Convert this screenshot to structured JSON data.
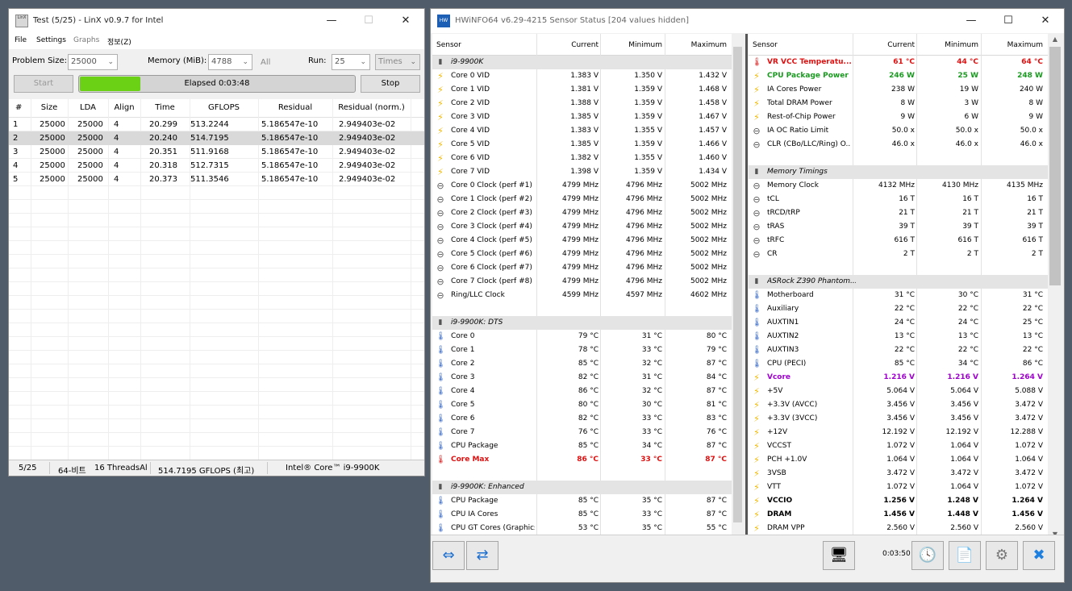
{
  "linx": {
    "title": "Test (5/25) - LinX v0.9.7 for Intel",
    "menu": [
      "File",
      "Settings",
      "Graphs",
      "정보(Z)"
    ],
    "problem_size_label": "Problem Size:",
    "problem_size_value": "25000",
    "memory_label": "Memory (MiB):",
    "memory_value": "4788",
    "all_label": "All",
    "run_label": "Run:",
    "run_value": "25",
    "times_value": "Times",
    "start_label": "Start",
    "stop_label": "Stop",
    "elapsed": "Elapsed 0:03:48",
    "progress": 0.22,
    "columns": [
      "#",
      "Size",
      "LDA",
      "Align",
      "Time",
      "GFLOPS",
      "Residual",
      "Residual (norm.)"
    ],
    "rows": [
      [
        "1",
        "25000",
        "25000",
        "4",
        "20.299",
        "513.2244",
        "5.186547e-10",
        "2.949403e-02"
      ],
      [
        "2",
        "25000",
        "25000",
        "4",
        "20.240",
        "514.7195",
        "5.186547e-10",
        "2.949403e-02"
      ],
      [
        "3",
        "25000",
        "25000",
        "4",
        "20.351",
        "511.9168",
        "5.186547e-10",
        "2.949403e-02"
      ],
      [
        "4",
        "25000",
        "25000",
        "4",
        "20.318",
        "512.7315",
        "5.186547e-10",
        "2.949403e-02"
      ],
      [
        "5",
        "25000",
        "25000",
        "4",
        "20.373",
        "511.3546",
        "5.186547e-10",
        "2.949403e-02"
      ]
    ],
    "status": [
      "5/25",
      "64-비트",
      "16 ThreadsAl",
      "514.7195 GFLOPS (최고)",
      "Intel® Core™ i9-9900K"
    ]
  },
  "hwinfo": {
    "title": "HWiNFO64 v6.29-4215 Sensor Status [204 values hidden]",
    "columns": [
      "Sensor",
      "Current",
      "Minimum",
      "Maximum"
    ],
    "left": [
      {
        "t": "group",
        "name": "i9-9900K"
      },
      {
        "t": "bolt",
        "name": "Core 0 VID",
        "cur": "1.383 V",
        "min": "1.350 V",
        "max": "1.432 V"
      },
      {
        "t": "bolt",
        "name": "Core 1 VID",
        "cur": "1.381 V",
        "min": "1.359 V",
        "max": "1.468 V"
      },
      {
        "t": "bolt",
        "name": "Core 2 VID",
        "cur": "1.388 V",
        "min": "1.359 V",
        "max": "1.458 V"
      },
      {
        "t": "bolt",
        "name": "Core 3 VID",
        "cur": "1.385 V",
        "min": "1.359 V",
        "max": "1.467 V"
      },
      {
        "t": "bolt",
        "name": "Core 4 VID",
        "cur": "1.383 V",
        "min": "1.355 V",
        "max": "1.457 V"
      },
      {
        "t": "bolt",
        "name": "Core 5 VID",
        "cur": "1.385 V",
        "min": "1.359 V",
        "max": "1.466 V"
      },
      {
        "t": "bolt",
        "name": "Core 6 VID",
        "cur": "1.382 V",
        "min": "1.355 V",
        "max": "1.460 V"
      },
      {
        "t": "bolt",
        "name": "Core 7 VID",
        "cur": "1.398 V",
        "min": "1.359 V",
        "max": "1.434 V"
      },
      {
        "t": "clk",
        "name": "Core 0 Clock (perf #1)",
        "cur": "4799 MHz",
        "min": "4796 MHz",
        "max": "5002 MHz"
      },
      {
        "t": "clk",
        "name": "Core 1 Clock (perf #2)",
        "cur": "4799 MHz",
        "min": "4796 MHz",
        "max": "5002 MHz"
      },
      {
        "t": "clk",
        "name": "Core 2 Clock (perf #3)",
        "cur": "4799 MHz",
        "min": "4796 MHz",
        "max": "5002 MHz"
      },
      {
        "t": "clk",
        "name": "Core 3 Clock (perf #4)",
        "cur": "4799 MHz",
        "min": "4796 MHz",
        "max": "5002 MHz"
      },
      {
        "t": "clk",
        "name": "Core 4 Clock (perf #5)",
        "cur": "4799 MHz",
        "min": "4796 MHz",
        "max": "5002 MHz"
      },
      {
        "t": "clk",
        "name": "Core 5 Clock (perf #6)",
        "cur": "4799 MHz",
        "min": "4796 MHz",
        "max": "5002 MHz"
      },
      {
        "t": "clk",
        "name": "Core 6 Clock (perf #7)",
        "cur": "4799 MHz",
        "min": "4796 MHz",
        "max": "5002 MHz"
      },
      {
        "t": "clk",
        "name": "Core 7 Clock (perf #8)",
        "cur": "4799 MHz",
        "min": "4796 MHz",
        "max": "5002 MHz"
      },
      {
        "t": "clk",
        "name": "Ring/LLC Clock",
        "cur": "4599 MHz",
        "min": "4597 MHz",
        "max": "4602 MHz"
      },
      {
        "t": "blank"
      },
      {
        "t": "group",
        "name": "i9-9900K: DTS"
      },
      {
        "t": "therm",
        "name": "Core 0",
        "cur": "79 °C",
        "min": "31 °C",
        "max": "80 °C"
      },
      {
        "t": "therm",
        "name": "Core 1",
        "cur": "78 °C",
        "min": "33 °C",
        "max": "79 °C"
      },
      {
        "t": "therm",
        "name": "Core 2",
        "cur": "85 °C",
        "min": "32 °C",
        "max": "87 °C"
      },
      {
        "t": "therm",
        "name": "Core 3",
        "cur": "82 °C",
        "min": "31 °C",
        "max": "84 °C"
      },
      {
        "t": "therm",
        "name": "Core 4",
        "cur": "86 °C",
        "min": "32 °C",
        "max": "87 °C"
      },
      {
        "t": "therm",
        "name": "Core 5",
        "cur": "80 °C",
        "min": "30 °C",
        "max": "81 °C"
      },
      {
        "t": "therm",
        "name": "Core 6",
        "cur": "82 °C",
        "min": "33 °C",
        "max": "83 °C"
      },
      {
        "t": "therm",
        "name": "Core 7",
        "cur": "76 °C",
        "min": "33 °C",
        "max": "76 °C"
      },
      {
        "t": "therm",
        "name": "CPU Package",
        "cur": "85 °C",
        "min": "34 °C",
        "max": "87 °C"
      },
      {
        "t": "therm",
        "name": "Core Max",
        "cur": "86 °C",
        "min": "33 °C",
        "max": "87 °C",
        "style": "red"
      },
      {
        "t": "blank"
      },
      {
        "t": "group",
        "name": "i9-9900K: Enhanced"
      },
      {
        "t": "therm",
        "name": "CPU Package",
        "cur": "85 °C",
        "min": "35 °C",
        "max": "87 °C"
      },
      {
        "t": "therm",
        "name": "CPU IA Cores",
        "cur": "85 °C",
        "min": "33 °C",
        "max": "87 °C"
      },
      {
        "t": "therm",
        "name": "CPU GT Cores (Graphics)",
        "cur": "53 °C",
        "min": "35 °C",
        "max": "55 °C"
      }
    ],
    "right": [
      {
        "t": "therm",
        "name": "VR VCC Temperatu...",
        "cur": "61 °C",
        "min": "44 °C",
        "max": "64 °C",
        "style": "red"
      },
      {
        "t": "bolt",
        "name": "CPU Package Power",
        "cur": "246 W",
        "min": "25 W",
        "max": "248 W",
        "style": "green"
      },
      {
        "t": "bolt",
        "name": "IA Cores Power",
        "cur": "238 W",
        "min": "19 W",
        "max": "240 W"
      },
      {
        "t": "bolt",
        "name": "Total DRAM Power",
        "cur": "8 W",
        "min": "3 W",
        "max": "8 W"
      },
      {
        "t": "bolt",
        "name": "Rest-of-Chip Power",
        "cur": "9 W",
        "min": "6 W",
        "max": "9 W"
      },
      {
        "t": "clk",
        "name": "IA OC Ratio Limit",
        "cur": "50.0 x",
        "min": "50.0 x",
        "max": "50.0 x"
      },
      {
        "t": "clk",
        "name": "CLR (CBo/LLC/Ring) O...",
        "cur": "46.0 x",
        "min": "46.0 x",
        "max": "46.0 x"
      },
      {
        "t": "blank"
      },
      {
        "t": "group",
        "name": "Memory Timings"
      },
      {
        "t": "clk",
        "name": "Memory Clock",
        "cur": "4132 MHz",
        "min": "4130 MHz",
        "max": "4135 MHz"
      },
      {
        "t": "clk",
        "name": "tCL",
        "cur": "16 T",
        "min": "16 T",
        "max": "16 T"
      },
      {
        "t": "clk",
        "name": "tRCD/tRP",
        "cur": "21 T",
        "min": "21 T",
        "max": "21 T"
      },
      {
        "t": "clk",
        "name": "tRAS",
        "cur": "39 T",
        "min": "39 T",
        "max": "39 T"
      },
      {
        "t": "clk",
        "name": "tRFC",
        "cur": "616 T",
        "min": "616 T",
        "max": "616 T"
      },
      {
        "t": "clk",
        "name": "CR",
        "cur": "2 T",
        "min": "2 T",
        "max": "2 T"
      },
      {
        "t": "blank"
      },
      {
        "t": "group",
        "name": "ASRock Z390 Phantom..."
      },
      {
        "t": "therm",
        "name": "Motherboard",
        "cur": "31 °C",
        "min": "30 °C",
        "max": "31 °C"
      },
      {
        "t": "therm",
        "name": "Auxiliary",
        "cur": "22 °C",
        "min": "22 °C",
        "max": "22 °C"
      },
      {
        "t": "therm",
        "name": "AUXTIN1",
        "cur": "24 °C",
        "min": "24 °C",
        "max": "25 °C"
      },
      {
        "t": "therm",
        "name": "AUXTIN2",
        "cur": "13 °C",
        "min": "13 °C",
        "max": "13 °C"
      },
      {
        "t": "therm",
        "name": "AUXTIN3",
        "cur": "22 °C",
        "min": "22 °C",
        "max": "22 °C"
      },
      {
        "t": "therm",
        "name": "CPU (PECI)",
        "cur": "85 °C",
        "min": "34 °C",
        "max": "86 °C"
      },
      {
        "t": "bolt",
        "name": "Vcore",
        "cur": "1.216 V",
        "min": "1.216 V",
        "max": "1.264 V",
        "style": "purple"
      },
      {
        "t": "bolt",
        "name": "+5V",
        "cur": "5.064 V",
        "min": "5.064 V",
        "max": "5.088 V"
      },
      {
        "t": "bolt",
        "name": "+3.3V (AVCC)",
        "cur": "3.456 V",
        "min": "3.456 V",
        "max": "3.472 V"
      },
      {
        "t": "bolt",
        "name": "+3.3V (3VCC)",
        "cur": "3.456 V",
        "min": "3.456 V",
        "max": "3.472 V"
      },
      {
        "t": "bolt",
        "name": "+12V",
        "cur": "12.192 V",
        "min": "12.192 V",
        "max": "12.288 V"
      },
      {
        "t": "bolt",
        "name": "VCCST",
        "cur": "1.072 V",
        "min": "1.064 V",
        "max": "1.072 V"
      },
      {
        "t": "bolt",
        "name": "PCH +1.0V",
        "cur": "1.064 V",
        "min": "1.064 V",
        "max": "1.064 V"
      },
      {
        "t": "bolt",
        "name": "3VSB",
        "cur": "3.472 V",
        "min": "3.472 V",
        "max": "3.472 V"
      },
      {
        "t": "bolt",
        "name": "VTT",
        "cur": "1.072 V",
        "min": "1.064 V",
        "max": "1.072 V"
      },
      {
        "t": "bolt",
        "name": "VCCIO",
        "cur": "1.256 V",
        "min": "1.248 V",
        "max": "1.264 V",
        "style": "bold"
      },
      {
        "t": "bolt",
        "name": "DRAM",
        "cur": "1.456 V",
        "min": "1.448 V",
        "max": "1.456 V",
        "style": "bold"
      },
      {
        "t": "bolt",
        "name": "DRAM VPP",
        "cur": "2.560 V",
        "min": "2.560 V",
        "max": "2.560 V"
      }
    ],
    "timer": "0:03:50",
    "icons": {
      "nav_left": "⇔",
      "nav_right": "⇔",
      "network": "network-icon",
      "clock": "clock-icon",
      "report": "report-icon",
      "settings": "gear-icon",
      "close": "close-icon"
    }
  }
}
